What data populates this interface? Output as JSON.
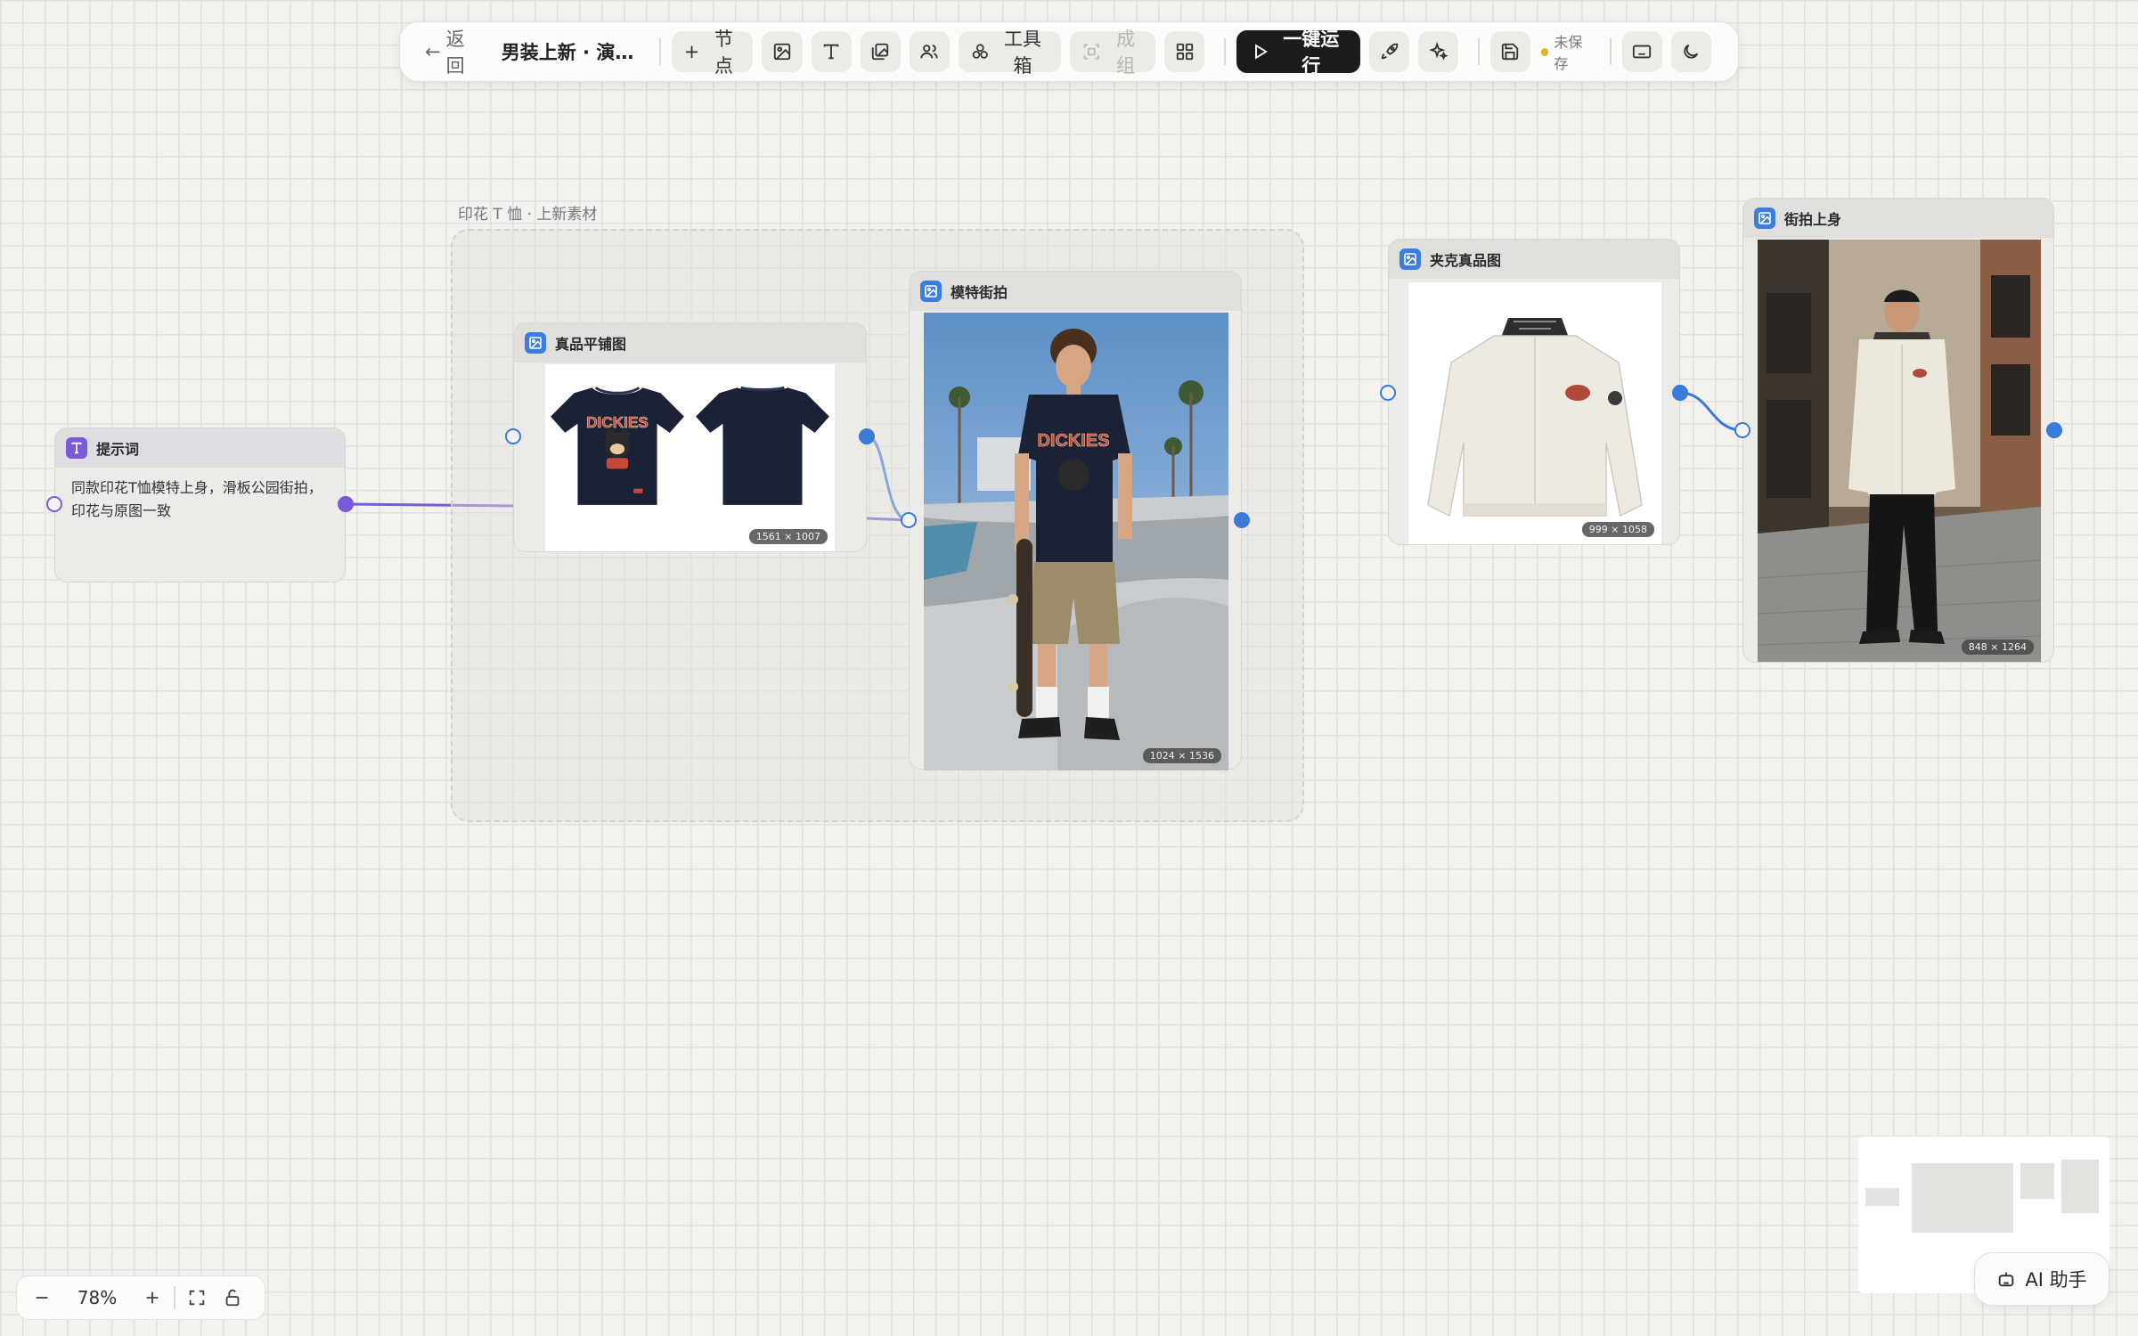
{
  "toolbar": {
    "back_label": "返回",
    "project_title": "男装上新 · 演示...",
    "add_node_label": "节点",
    "toolbox_label": "工具箱",
    "group_label": "成组",
    "run_label": "一键运行",
    "save_status": "未保存"
  },
  "group": {
    "label": "印花 T 恤 · 上新素材"
  },
  "nodes": {
    "prompt": {
      "title": "提示词",
      "text": "同款印花T恤模特上身，滑板公园街拍，印花与原图一致"
    },
    "flatlay": {
      "title": "真品平铺图",
      "size": "1561 × 1007"
    },
    "model_street": {
      "title": "模特街拍",
      "size": "1024 × 1536"
    },
    "jacket": {
      "title": "夹克真品图",
      "size": "999 × 1058"
    },
    "street_on_body": {
      "title": "街拍上身",
      "size": "848 × 1264"
    }
  },
  "zoom": {
    "level": "78%"
  },
  "ai_assistant": {
    "label": "AI 助手"
  },
  "colors": {
    "accent_blue": "#3a7ad9",
    "accent_purple": "#7b5ad8",
    "run_button": "#1c1c1c",
    "unsaved_dot": "#e8b422"
  }
}
